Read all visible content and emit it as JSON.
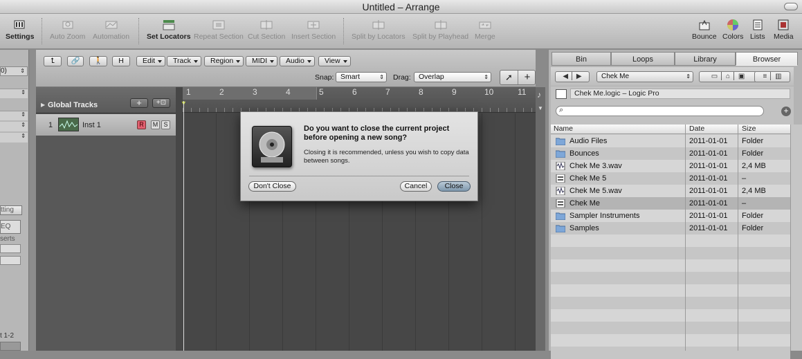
{
  "window": {
    "title": "Untitled – Arrange"
  },
  "toolbar": {
    "settings": "Settings",
    "auto_zoom": "Auto Zoom",
    "automation": "Automation",
    "set_locators": "Set Locators",
    "repeat_section": "Repeat Section",
    "cut_section": "Cut Section",
    "insert_section": "Insert Section",
    "split_by_locators": "Split by Locators",
    "split_by_playhead": "Split by Playhead",
    "merge": "Merge",
    "bounce": "Bounce",
    "colors": "Colors",
    "lists": "Lists",
    "media": "Media"
  },
  "left_fragments": {
    "top": "0)",
    "setting": "tting",
    "eq": "EQ",
    "inserts": "serts",
    "bottom": "t 1-2"
  },
  "arrange_header": {
    "h_button": "H",
    "menus": [
      "Edit",
      "Track",
      "Region",
      "MIDI",
      "Audio",
      "View"
    ],
    "snap_label": "Snap:",
    "snap_value": "Smart",
    "drag_label": "Drag:",
    "drag_value": "Overlap"
  },
  "global_tracks": {
    "label": "Global Tracks"
  },
  "track": {
    "number": "1",
    "name": "Inst 1",
    "r": "R",
    "m": "M",
    "s": "S"
  },
  "ruler": {
    "bars": [
      "1",
      "2",
      "3",
      "4",
      "5",
      "6",
      "7",
      "8",
      "9",
      "10",
      "11"
    ]
  },
  "dialog": {
    "title": "Do you want to close the current project before opening a new song?",
    "message": "Closing it is recommended, unless you wish to copy data between songs.",
    "dont_close": "Don't Close",
    "cancel": "Cancel",
    "close": "Close"
  },
  "browser": {
    "tabs": [
      "Bin",
      "Loops",
      "Library",
      "Browser"
    ],
    "active_tab": "Browser",
    "location": "Chek Me",
    "path": "Chek Me.logic – Logic Pro",
    "search_placeholder": "",
    "columns": {
      "name": "Name",
      "date": "Date",
      "size": "Size"
    },
    "files": [
      {
        "name": "Audio Files",
        "date": "2011-01-01",
        "size": "Folder",
        "icon": "folder-icon"
      },
      {
        "name": "Bounces",
        "date": "2011-01-01",
        "size": "Folder",
        "icon": "folder-icon"
      },
      {
        "name": "Chek Me 3.wav",
        "date": "2011-01-01",
        "size": "2,4 MB",
        "icon": "audio-file-icon"
      },
      {
        "name": "Chek Me 5",
        "date": "2011-01-01",
        "size": "–",
        "icon": "project-file-icon"
      },
      {
        "name": "Chek Me 5.wav",
        "date": "2011-01-01",
        "size": "2,4 MB",
        "icon": "audio-file-icon"
      },
      {
        "name": "Chek Me",
        "date": "2011-01-01",
        "size": "–",
        "icon": "project-file-icon"
      },
      {
        "name": "Sampler Instruments",
        "date": "2011-01-01",
        "size": "Folder",
        "icon": "folder-icon"
      },
      {
        "name": "Samples",
        "date": "2011-01-01",
        "size": "Folder",
        "icon": "folder-icon"
      }
    ],
    "selected_index": 5
  },
  "colors": {
    "accent": "#7f98ad",
    "record": "#e06070",
    "selection": "#b4b4b4"
  }
}
